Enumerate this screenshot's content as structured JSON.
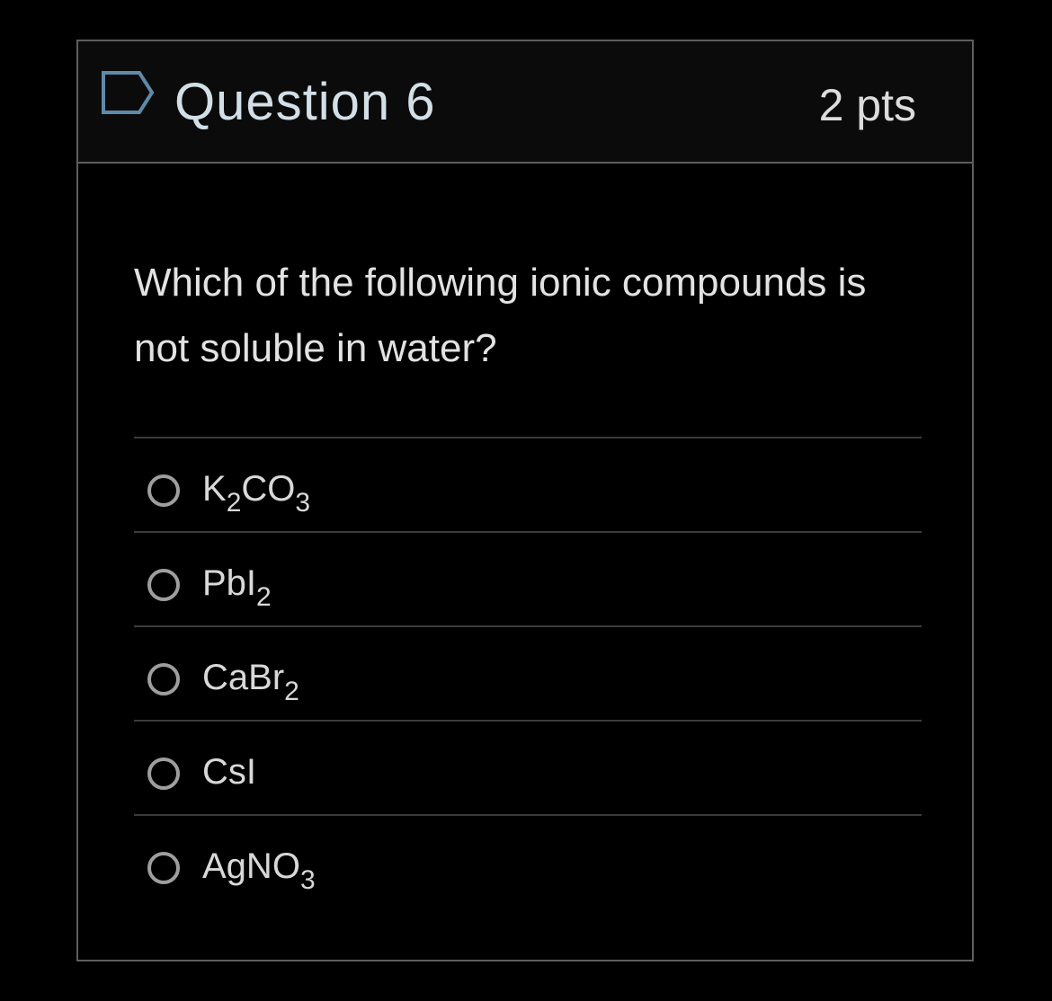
{
  "question": {
    "title": "Question 6",
    "points": "2 pts",
    "flag_icon": "flag-outline-icon",
    "text": "Which of the following ionic compounds is not soluble in water?"
  },
  "answers": [
    {
      "main": "K",
      "sub1": "2",
      "mid": "CO",
      "sub2": "3"
    },
    {
      "main": "PbI",
      "sub1": "2",
      "mid": "",
      "sub2": ""
    },
    {
      "main": "CaBr",
      "sub1": "2",
      "mid": "",
      "sub2": ""
    },
    {
      "main": "CsI",
      "sub1": "",
      "mid": "",
      "sub2": ""
    },
    {
      "main": "AgNO",
      "sub1": "3",
      "mid": "",
      "sub2": ""
    }
  ],
  "colors": {
    "background": "#000000",
    "header_bg": "#0b0b0b",
    "border": "#5e5e5e",
    "title_text": "#d3dfe7",
    "flag_stroke": "#5e8aa8"
  }
}
